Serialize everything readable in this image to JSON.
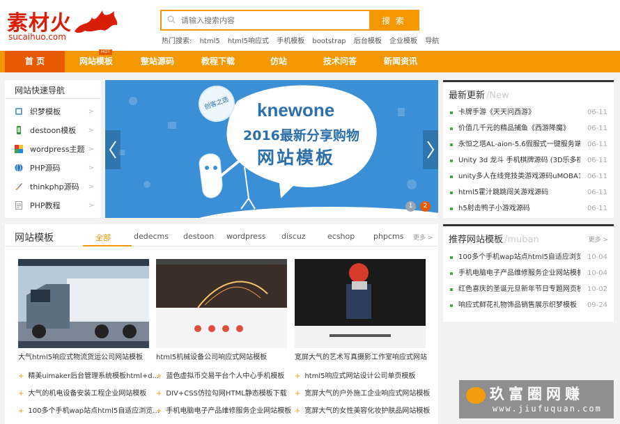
{
  "header": {
    "logo_cn": "素材火",
    "logo_en": "sucaihuo.com",
    "search_placeholder": "请输入搜索内容",
    "search_button": "搜 索",
    "hot_label": "热门搜索:",
    "hot_terms": [
      "html5",
      "html5响应式",
      "手机模板",
      "bootstrap",
      "后台模板",
      "企业模板",
      "导航"
    ]
  },
  "nav": {
    "items": [
      "首 页",
      "网站模板",
      "整站源码",
      "教程下载",
      "仿站",
      "技术问答",
      "新闻资讯"
    ],
    "hot_badge": "HOT"
  },
  "quick_nav": {
    "title": "网站快速导航",
    "items": [
      "织梦模板",
      "destoon模板",
      "wordpress主题",
      "PHP源码",
      "thinkphp源码",
      "PHP教程"
    ]
  },
  "banner": {
    "brand": "knewone",
    "line1": "2016最新分享购物",
    "line2": "网站模板",
    "stamp": "创客之选",
    "pages": [
      "1",
      "2"
    ],
    "active_page": 2
  },
  "latest": {
    "title": "最新更新",
    "title_en": "/New",
    "items": [
      {
        "title": "卡牌手游《天天问西游》",
        "date": "06-11"
      },
      {
        "title": "价值几千元的精品捕鱼《西游降魔》",
        "date": "06-11"
      },
      {
        "title": "永恒之塔AL-aion-5.6假服式一键服务端+...",
        "date": "06-11"
      },
      {
        "title": "Unity 3d 龙斗 手机棋牌源码 (3D乐多棋...",
        "date": "06-11"
      },
      {
        "title": "unity多人在线竞技类游戏源码uMOBA1...",
        "date": "06-11"
      },
      {
        "title": "html5霍汁跳跳闯关游戏源码",
        "date": "06-11"
      },
      {
        "title": "h5射击鸭子小游戏源码",
        "date": "06-11"
      }
    ]
  },
  "templates": {
    "title": "网站模板",
    "tabs": [
      "全部",
      "dedecms",
      "destoon",
      "wordpress",
      "discuz",
      "ecshop",
      "phpcms"
    ],
    "more": "更多 >",
    "cards": [
      {
        "caption": "大气html5响应式物流货运公司网站模板"
      },
      {
        "caption": "html5机械设备公司响应式网站模板"
      },
      {
        "caption": "宽屏大气的艺术写真摄影工作室响应式网站"
      }
    ],
    "sub_items": [
      [
        "精美uimaker后台管理系统模板html+d...",
        "蓝色虚拟币交易平台个人中心手机模板",
        "html5响应式网站设计公司单页模板"
      ],
      [
        "大气的机电设备安装工程企业网站模板",
        "DIV+CSS仿拉勾网HTML静态模板下载",
        "宽屏大气的户外施工企业响应式网站模板"
      ],
      [
        "100多个手机wap站点html5自适应浏览...",
        "手机电脑电子产品维修服务企业网站模板",
        "宽屏大气的女性美容化妆护肤品网站模板"
      ]
    ]
  },
  "recommend": {
    "title": "推荐网站模板",
    "title_en": "/muban",
    "more": "更多 >",
    "items": [
      {
        "title": "100多个手机wap站点html5自适应浏览...",
        "date": "10-04"
      },
      {
        "title": "手机电脑电子产品维修服务企业网站模板",
        "date": "10-04"
      },
      {
        "title": "红色喜庆的圣诞元旦新年节日专题网页模...",
        "date": "10-02"
      },
      {
        "title": "响应式鲜花礼物饰品销售展示织梦模板",
        "date": "09-24"
      }
    ]
  },
  "watermark": {
    "cn": "玖富圈网赚",
    "url": "www.jiufuquan.com"
  },
  "colors": {
    "accent": "#f39800",
    "home": "#e85a00",
    "banner": "#3a8fd6",
    "green_dot": "#3da93d"
  }
}
